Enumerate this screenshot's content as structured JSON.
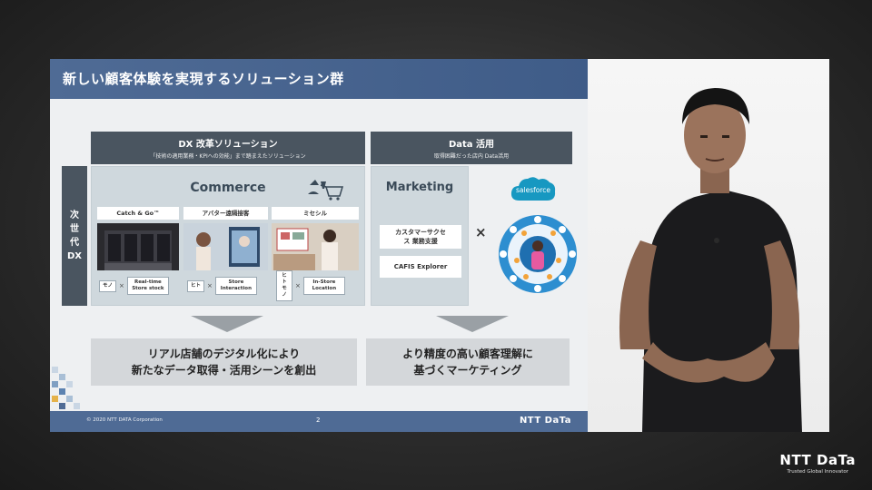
{
  "slide": {
    "title": "新しい顧客体験を実現するソリューション群",
    "dx_header": {
      "title": "DX 改革ソリューション",
      "subtitle": "「技術の適用業務・KPIへの効能」まで踏まえたソリューション"
    },
    "data_header": {
      "title": "Data 活用",
      "subtitle": "取得困難だった店内 Data活用"
    },
    "side_label": [
      "次",
      "世",
      "代",
      "DX"
    ],
    "commerce": {
      "title": "Commerce",
      "columns": [
        {
          "head": "Catch & Go™",
          "tags": [
            "モノ",
            "Real-time Store stock"
          ]
        },
        {
          "head": "アバター遠隔接客",
          "tags": [
            "ヒト",
            "Store Interaction"
          ]
        },
        {
          "head": "ミセシル",
          "tags": [
            "ヒト モノ",
            "In-Store Location"
          ]
        }
      ],
      "times": "×"
    },
    "marketing": {
      "title": "Marketing",
      "items": [
        "カスタマーサクセス 業務支援",
        "CAFIS Explorer"
      ]
    },
    "times_big": "×",
    "salesforce_label": "salesforce",
    "results": [
      [
        "リアル店舗のデジタル化により",
        "新たなデータ取得・活用シーンを創出"
      ],
      [
        "より精度の高い顧客理解に",
        "基づくマーケティング"
      ]
    ],
    "footer": {
      "copyright": "© 2020 NTT DATA Corporation",
      "page": "2",
      "logo": "NTT DaTa"
    }
  },
  "brand": {
    "name": "NTT DaTa",
    "tagline": "Trusted Global Innovator"
  },
  "colors": {
    "title_bar": "#4f6b95",
    "header_dark": "#4a5560",
    "panel": "#cfd8dd",
    "result": "#d4d7da",
    "salesforce": "#1798c1"
  }
}
